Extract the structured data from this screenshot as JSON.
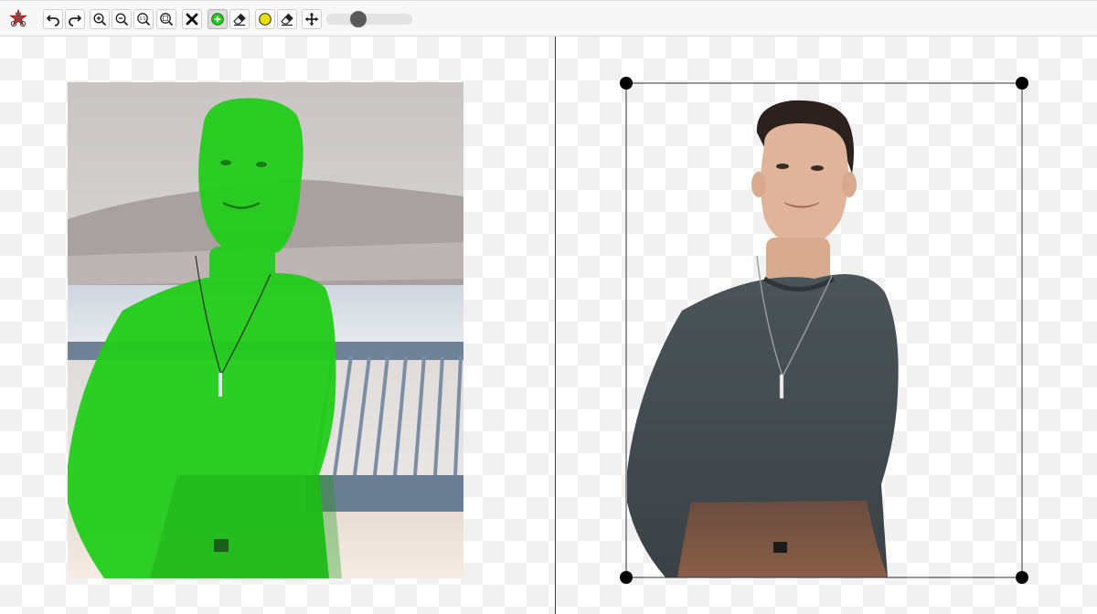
{
  "toolbar": {
    "logo_icon": "scissors-star-logo",
    "buttons": [
      {
        "name": "undo-button",
        "icon": "undo-icon",
        "active": false
      },
      {
        "name": "redo-button",
        "icon": "redo-icon",
        "active": false
      },
      {
        "name": "zoom-in-button",
        "icon": "zoom-in-icon",
        "active": false
      },
      {
        "name": "zoom-out-button",
        "icon": "zoom-out-icon",
        "active": false
      },
      {
        "name": "zoom-actual-size-button",
        "icon": "zoom-1-1-icon",
        "label": "1:1",
        "active": false
      },
      {
        "name": "zoom-fit-button",
        "icon": "zoom-fit-icon",
        "active": false
      },
      {
        "name": "clear-button",
        "icon": "x-icon",
        "active": false
      },
      {
        "name": "add-foreground-button",
        "icon": "green-plus-icon",
        "active": true
      },
      {
        "name": "erase-foreground-button",
        "icon": "eraser-icon",
        "active": false
      },
      {
        "name": "mark-yellow-button",
        "icon": "yellow-dot-icon",
        "active": false
      },
      {
        "name": "erase-mark-button",
        "icon": "eraser-icon",
        "active": false
      },
      {
        "name": "move-button",
        "icon": "move-arrows-icon",
        "active": false
      }
    ],
    "brush_size_slider": {
      "value": 0.37
    }
  },
  "colors": {
    "mask_green": "#22cc1a",
    "checker": "#f1f1f1",
    "yellow_marker": "#e8e000",
    "divider": "#3c3c3c",
    "handles": "#000000"
  },
  "panes": {
    "left": {
      "content": "original-photo-with-green-foreground-mask"
    },
    "right": {
      "content": "cutout-result-with-crop-box",
      "crop_handles": 4
    }
  }
}
